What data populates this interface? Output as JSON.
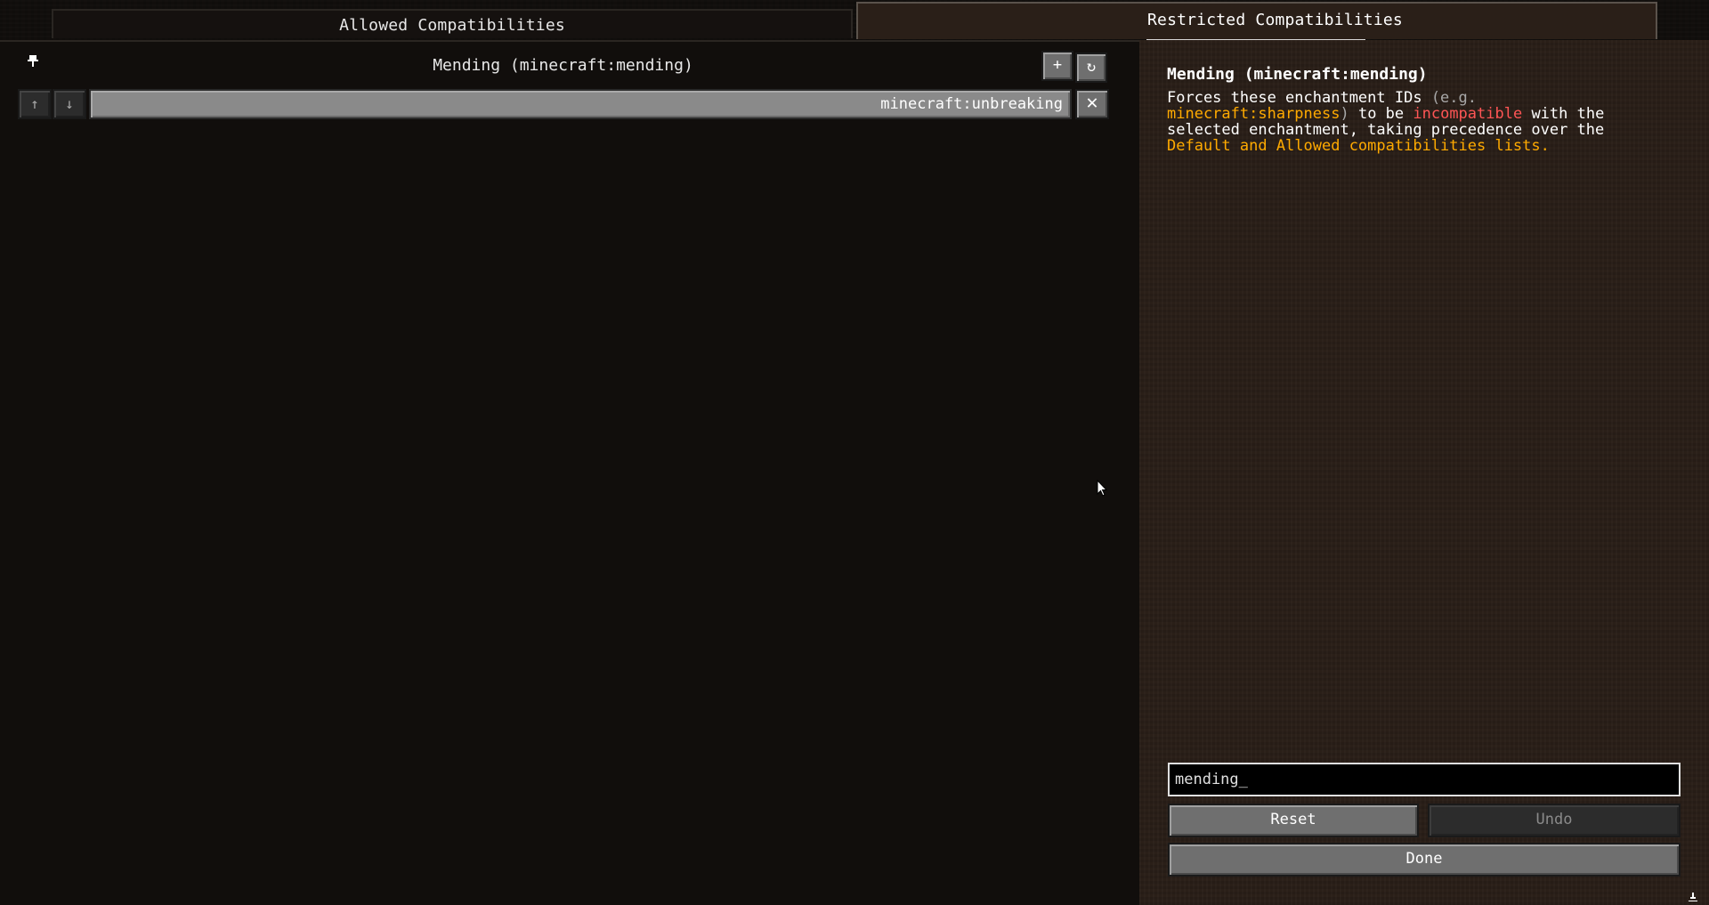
{
  "tabs": {
    "allowed": "Allowed Compatibilities",
    "restricted": "Restricted Compatibilities"
  },
  "list": {
    "header_title": "Mending (minecraft:mending)",
    "add_label": "+",
    "refresh_label": "↻",
    "entries": [
      {
        "value": "minecraft:unbreaking",
        "up_label": "↑",
        "down_label": "↓",
        "remove_label": "✕"
      }
    ]
  },
  "description": {
    "title": "Mending (minecraft:mending)",
    "part1": "Forces these enchantment IDs ",
    "example": "(e.g. ",
    "example_id": "minecraft:sharpness",
    "example_close": ")",
    "part2": " to be ",
    "keyword": "incompatible",
    "part3": " with the selected enchantment, taking precedence over the ",
    "lists": "Default and Allowed compatibilities lists",
    "period": "."
  },
  "input": {
    "value": "mending_"
  },
  "buttons": {
    "reset": "Reset",
    "undo": "Undo",
    "done": "Done"
  },
  "colors": {
    "highlight_gold": "#ffaa00",
    "highlight_red": "#ff5555",
    "muted_gray": "#a8a8a8"
  }
}
